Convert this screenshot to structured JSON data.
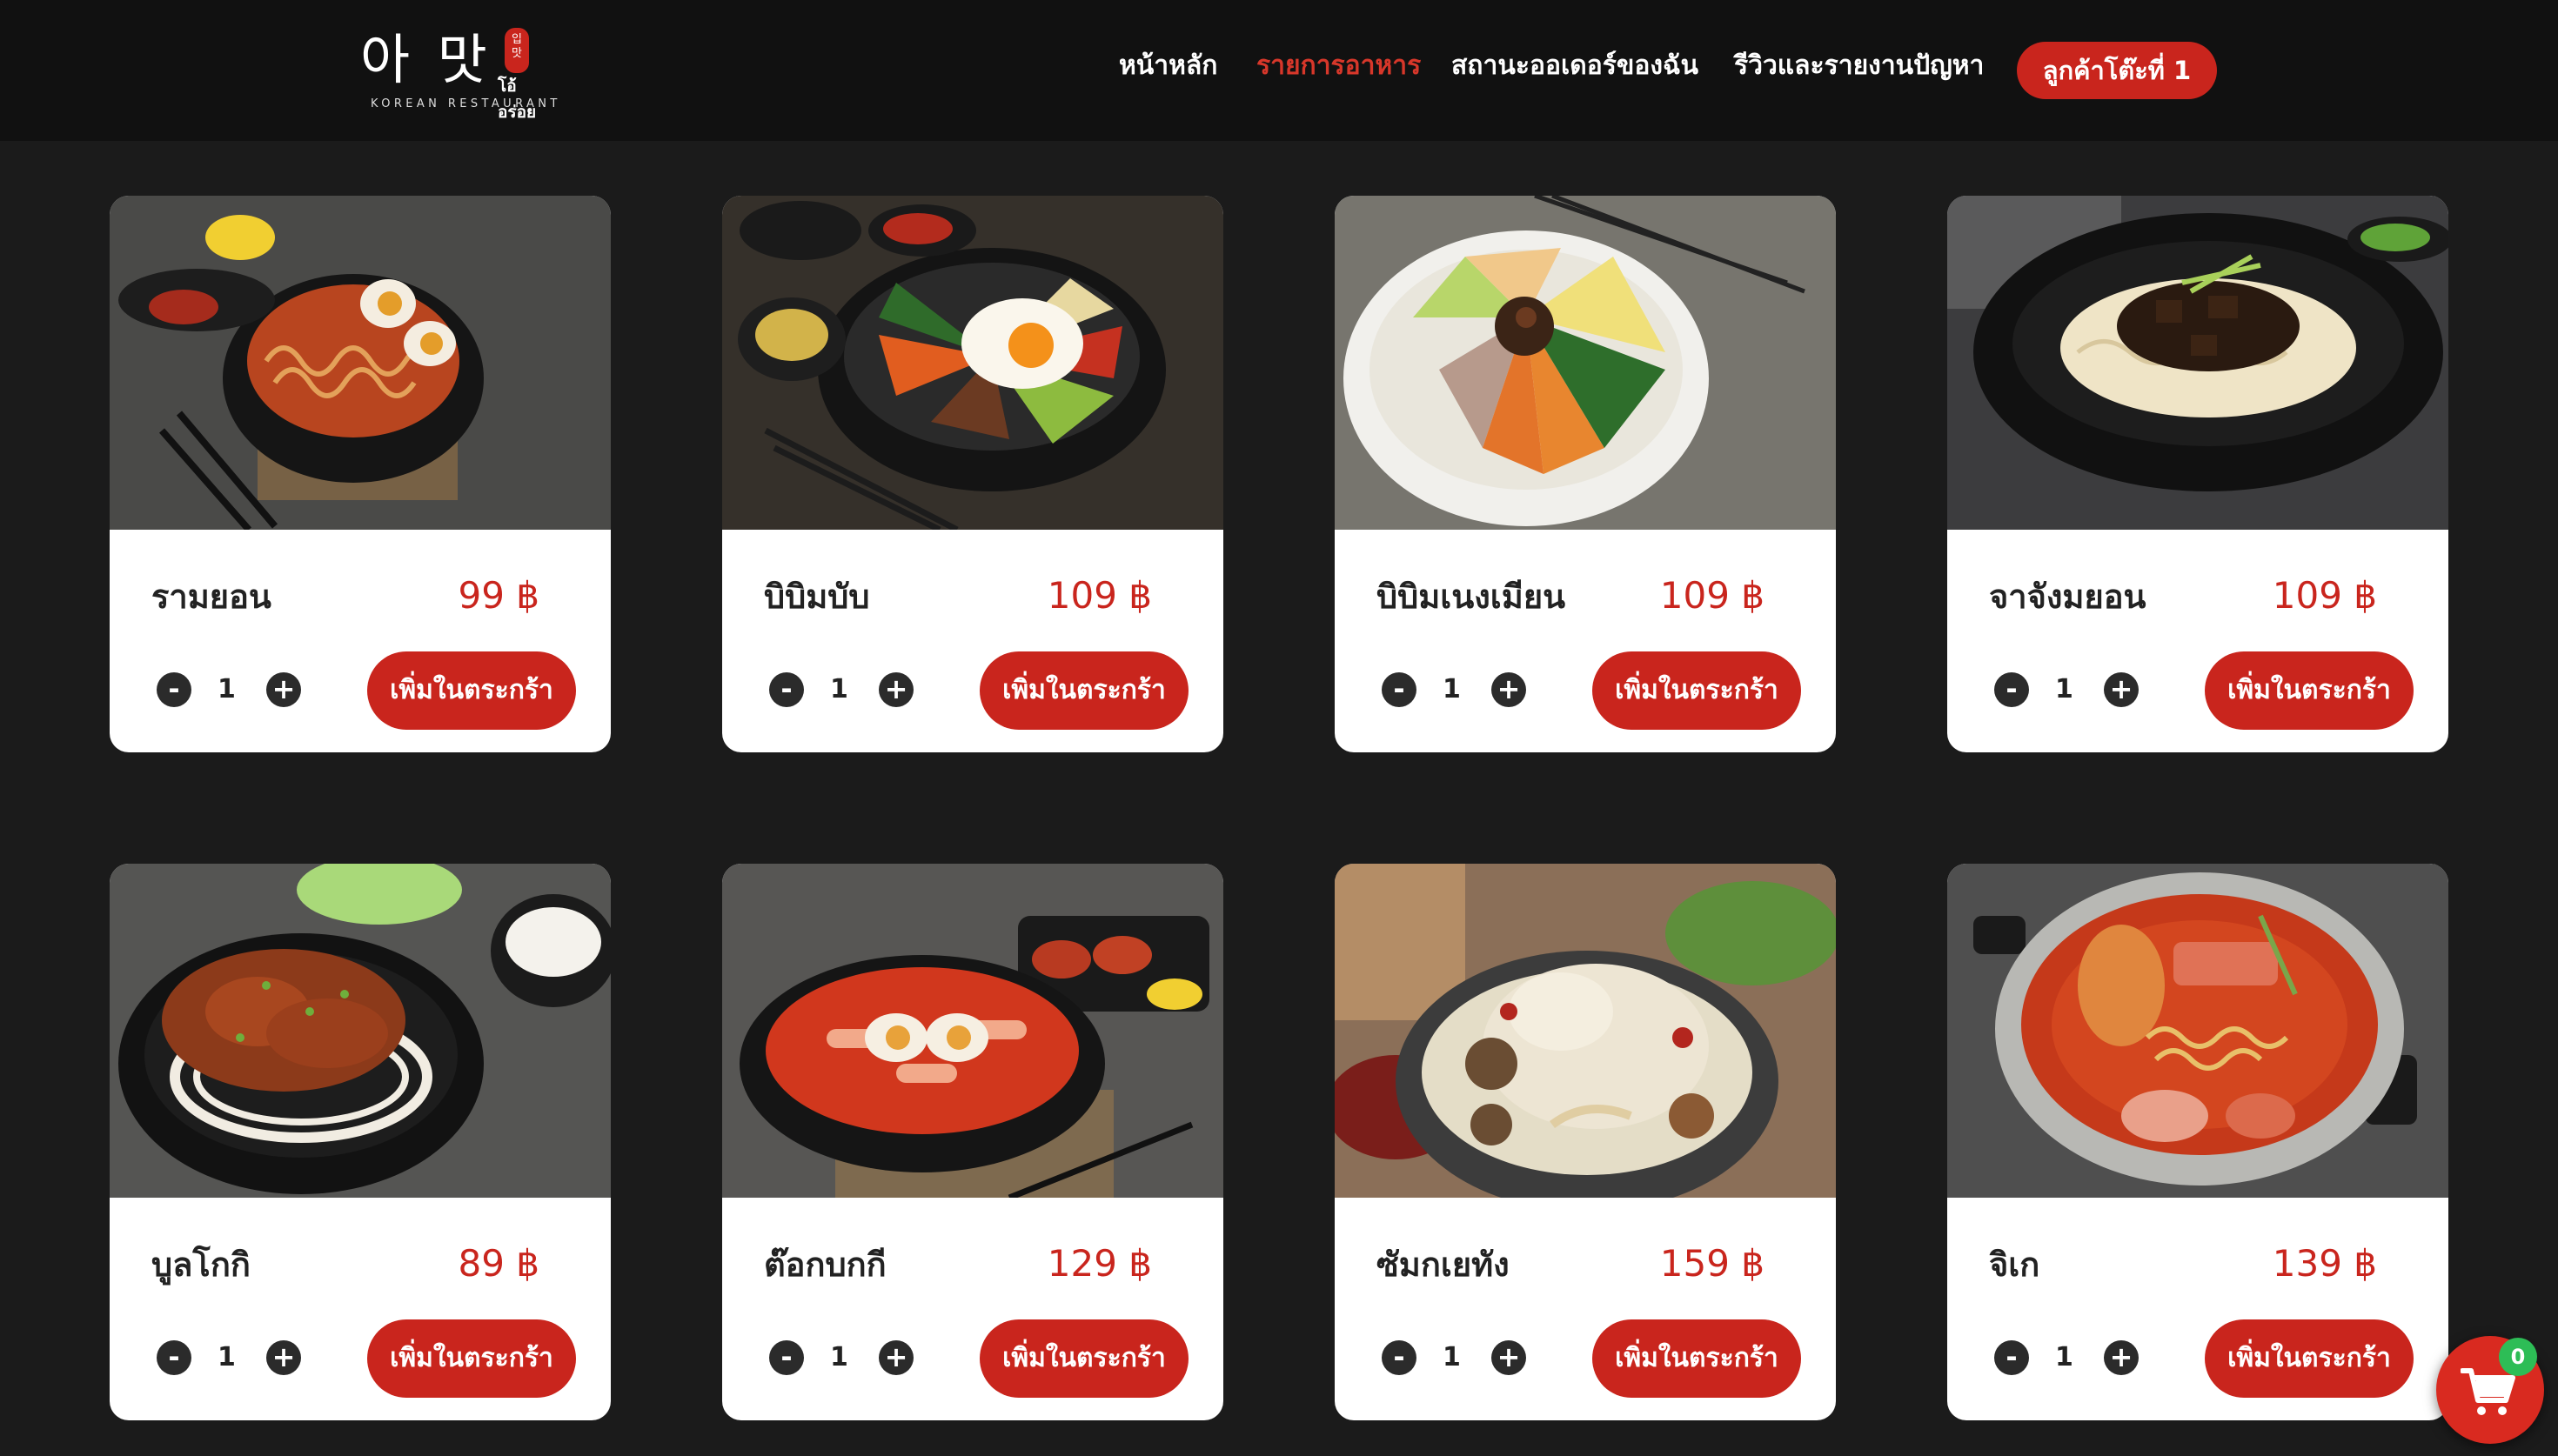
{
  "brand": {
    "logo_text": "아 맛",
    "logo_seal": "입 맛",
    "logo_thai": "โอ้อร่อย",
    "logo_subtitle": "KOREAN RESTAURANT"
  },
  "nav": {
    "items": [
      {
        "label": "หน้าหลัก",
        "active": false
      },
      {
        "label": "รายการอาหาร",
        "active": true
      },
      {
        "label": "สถานะออเดอร์ของฉัน",
        "active": false
      },
      {
        "label": "รีวิวและรายงานปัญหา",
        "active": false
      }
    ],
    "table_label": "ลูกค้าโต๊ะที่ 1"
  },
  "menu": {
    "add_label": "เพิ่มในตระกร้า",
    "minus_symbol": "-",
    "plus_symbol": "+",
    "items": [
      {
        "name": "รามยอน",
        "price": "99 ฿",
        "qty": "1",
        "image": "ramyeon-photo"
      },
      {
        "name": "บิบิมบับ",
        "price": "109 ฿",
        "qty": "1",
        "image": "bibimbap-photo"
      },
      {
        "name": "บิบิมเนงเมียน",
        "price": "109 ฿",
        "qty": "1",
        "image": "bibim-naengmyeon-photo"
      },
      {
        "name": "จาจังมยอน",
        "price": "109 ฿",
        "qty": "1",
        "image": "jajangmyeon-photo"
      },
      {
        "name": "บูลโกกิ",
        "price": "89 ฿",
        "qty": "1",
        "image": "bulgogi-photo"
      },
      {
        "name": "ต๊อกบกกี",
        "price": "129 ฿",
        "qty": "1",
        "image": "tteokbokki-photo"
      },
      {
        "name": "ซัมกเยทัง",
        "price": "159 ฿",
        "qty": "1",
        "image": "samgyetang-photo"
      },
      {
        "name": "จิเก",
        "price": "139 ฿",
        "qty": "1",
        "image": "jjigae-photo"
      }
    ]
  },
  "cart": {
    "count": "0"
  },
  "colors": {
    "accent": "#c9251d",
    "background": "#1b1b1b",
    "navbar": "#111111",
    "badge": "#2dbd56"
  }
}
